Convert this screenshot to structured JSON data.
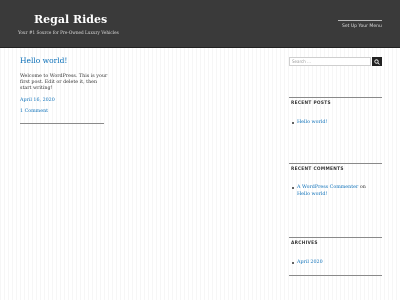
{
  "header": {
    "site_title": "Regal Rides",
    "tagline": "Your #1 Source for Pre-Owned Luxury Vehicles",
    "menu_link": "Set Up Your Menu",
    "background": "#3a3a3a"
  },
  "post": {
    "title": "Hello world!",
    "excerpt": "Welcome to WordPress. This is your first post. Edit or delete it, then start writing!",
    "date": "April 16, 2020",
    "comments": "1 Comment"
  },
  "sidebar": {
    "search": {
      "placeholder": "Search …",
      "icon": "search-icon"
    },
    "recent_posts": {
      "title": "RECENT POSTS",
      "items": [
        "Hello world!"
      ]
    },
    "recent_comments": {
      "title": "RECENT COMMENTS",
      "items": [
        {
          "author": "A WordPress Commenter",
          "on": "on",
          "post": "Hello world!"
        }
      ]
    },
    "archives": {
      "title": "ARCHIVES",
      "items": [
        "April 2020"
      ]
    }
  },
  "colors": {
    "link": "#0a6fb8",
    "text": "#333333"
  }
}
